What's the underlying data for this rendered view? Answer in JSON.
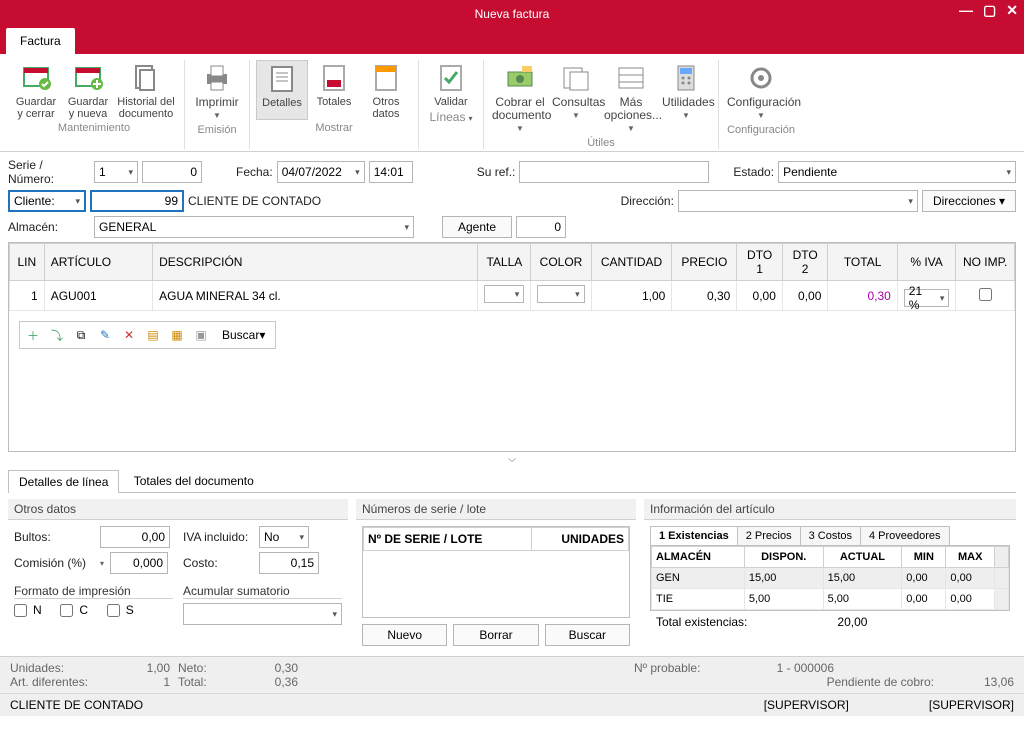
{
  "window": {
    "title": "Nueva factura"
  },
  "ribbon": {
    "tab": "Factura",
    "groups": {
      "mantenimiento": {
        "label": "Mantenimiento",
        "save_close": "Guardar y cerrar",
        "save_new": "Guardar y nueva",
        "history": "Historial del documento"
      },
      "emision": {
        "label": "Emisión",
        "print": "Imprimir"
      },
      "mostrar": {
        "label": "Mostrar",
        "details": "Detalles",
        "totals": "Totales",
        "other": "Otros datos"
      },
      "lineas": {
        "label": "Líneas",
        "validate": "Validar"
      },
      "utiles": {
        "label": "Útiles",
        "cobrar": "Cobrar el documento",
        "consultas": "Consultas",
        "mas": "Más opciones...",
        "utilidades": "Utilidades"
      },
      "config": {
        "label": "Configuración",
        "config": "Configuración"
      }
    }
  },
  "header": {
    "serie_label": "Serie / Número:",
    "serie": "1",
    "numero": "0",
    "fecha_label": "Fecha:",
    "fecha": "04/07/2022",
    "hora": "14:01",
    "suref_label": "Su ref.:",
    "suref": "",
    "estado_label": "Estado:",
    "estado": "Pendiente",
    "cliente_label": "Cliente:",
    "cliente_code": "99",
    "cliente_name": "CLIENTE DE CONTADO",
    "direccion_label": "Dirección:",
    "direcciones_btn": "Direcciones",
    "almacen_label": "Almacén:",
    "almacen": "GENERAL",
    "agente_btn": "Agente",
    "agente": "0"
  },
  "grid": {
    "cols": {
      "lin": "LIN",
      "articulo": "ARTÍCULO",
      "descripcion": "DESCRIPCIÓN",
      "talla": "TALLA",
      "color": "COLOR",
      "cantidad": "CANTIDAD",
      "precio": "PRECIO",
      "dto1": "DTO 1",
      "dto2": "DTO 2",
      "total": "TOTAL",
      "iva": "% IVA",
      "noimp": "NO IMP."
    },
    "rows": [
      {
        "lin": "1",
        "articulo": "AGU001",
        "descripcion": "AGUA MINERAL 34 cl.",
        "cantidad": "1,00",
        "precio": "0,30",
        "dto1": "0,00",
        "dto2": "0,00",
        "total": "0,30",
        "iva": "21 %"
      }
    ],
    "toolbar_search": "Buscar"
  },
  "tabs": {
    "details": "Detalles de línea",
    "totals": "Totales del documento"
  },
  "otros": {
    "title": "Otros datos",
    "bultos_l": "Bultos:",
    "bultos": "0,00",
    "iva_l": "IVA incluido:",
    "iva": "No",
    "comision_l": "Comisión (%)",
    "comision": "0,000",
    "costo_l": "Costo:",
    "costo": "0,15",
    "formato_l": "Formato de impresión",
    "acum_l": "Acumular sumatorio",
    "n": "N",
    "c": "C",
    "s": "S"
  },
  "lote": {
    "title": "Números de serie / lote",
    "col1": "Nº DE SERIE / LOTE",
    "col2": "UNIDADES",
    "nuevo": "Nuevo",
    "borrar": "Borrar",
    "buscar": "Buscar"
  },
  "info": {
    "title": "Información del artículo",
    "tabs": {
      "t1": "1 Existencias",
      "t2": "2 Precios",
      "t3": "3 Costos",
      "t4": "4 Proveedores"
    },
    "cols": {
      "alm": "ALMACÉN",
      "disp": "DISPON.",
      "act": "ACTUAL",
      "min": "MIN",
      "max": "MAX"
    },
    "rows": [
      {
        "alm": "GEN",
        "disp": "15,00",
        "act": "15,00",
        "min": "0,00",
        "max": "0,00"
      },
      {
        "alm": "TIE",
        "disp": "5,00",
        "act": "5,00",
        "min": "0,00",
        "max": "0,00"
      }
    ],
    "total_l": "Total existencias:",
    "total": "20,00"
  },
  "footer": {
    "unidades_l": "Unidades:",
    "unidades": "1,00",
    "neto_l": "Neto:",
    "neto": "0,30",
    "artdif_l": "Art. diferentes:",
    "artdif": "1",
    "total_l": "Total:",
    "total": "0,36",
    "nprob_l": "Nº probable:",
    "nprob": "1 - 000006",
    "pend_l": "Pendiente de cobro:",
    "pend": "13,06"
  },
  "status": {
    "client": "CLIENTE DE CONTADO",
    "user1": "[SUPERVISOR]",
    "user2": "[SUPERVISOR]"
  }
}
